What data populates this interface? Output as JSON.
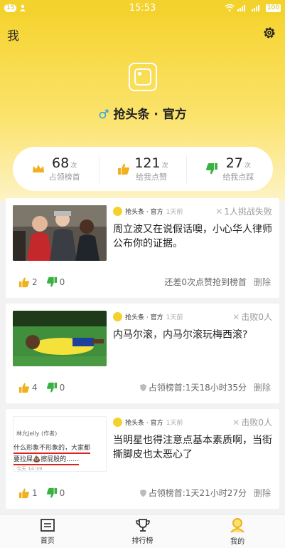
{
  "status_bar": {
    "notif_badge": "15",
    "time": "15:53",
    "battery": "100"
  },
  "header": {
    "title": "我",
    "profile_name": "抢头条 · 官方",
    "gender_symbol": "♂"
  },
  "stats": [
    {
      "value": "68",
      "unit": "次",
      "label": "占领榜首",
      "icon": "crown-icon"
    },
    {
      "value": "121",
      "unit": "次",
      "label": "给我点赞",
      "icon": "thumbs-up-icon"
    },
    {
      "value": "27",
      "unit": "次",
      "label": "给我点踩",
      "icon": "thumbs-down-icon"
    }
  ],
  "posts": [
    {
      "author": "抢头条 · 官方",
      "time": "1天前",
      "status": "1人挑战失败",
      "title": "周立波又在说假话噢，小心华人律师公布你的证据。",
      "likes": "2",
      "dislikes": "0",
      "info": "还差0次点赞抢到榜首",
      "delete": "删除"
    },
    {
      "author": "抢头条 · 官方",
      "time": "1天前",
      "status": "击败0人",
      "title": "内马尔滚，内马尔滚玩梅西滚?",
      "likes": "4",
      "dislikes": "0",
      "info": "占领榜首:1天18小时35分",
      "delete": "删除"
    },
    {
      "author": "抢头条 · 官方",
      "time": "1天前",
      "status": "击败0人",
      "title": "当明星也得注意点基本素质啊，当街撕脚皮也太恶心了",
      "likes": "1",
      "dislikes": "0",
      "info": "占领榜首:1天21小时27分",
      "delete": "删除",
      "thumb_text": {
        "user": "林允Jelly (作者)",
        "line1": "什么形象不形象的，大家都",
        "line2": "要拉屎💩擦屁股的……",
        "date": "今天 14:39"
      }
    }
  ],
  "tabs": [
    {
      "label": "首页",
      "icon": "home-icon"
    },
    {
      "label": "排行榜",
      "icon": "trophy-icon"
    },
    {
      "label": "我的",
      "icon": "profile-icon"
    }
  ],
  "colors": {
    "accent": "#f4d22e",
    "like": "#f0b020",
    "dislike": "#3bb043"
  }
}
